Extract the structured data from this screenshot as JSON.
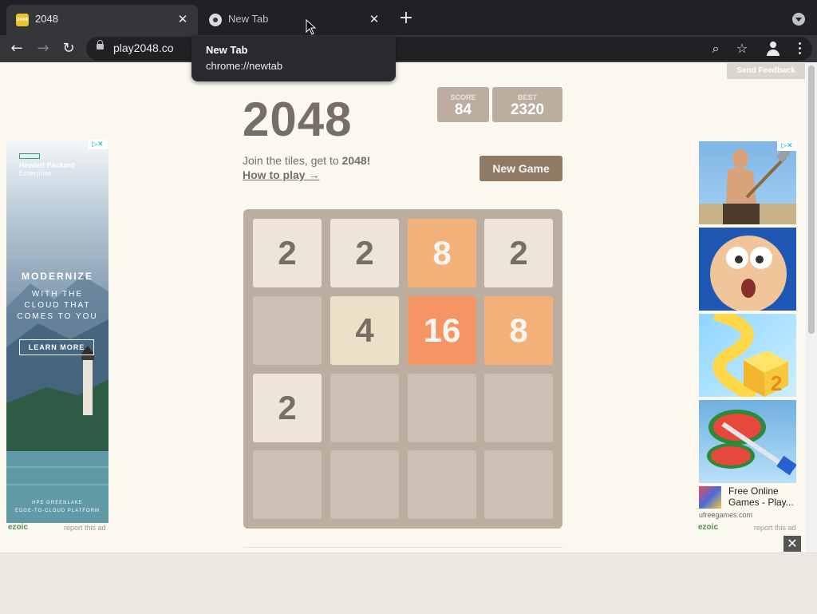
{
  "browser": {
    "tabs": [
      {
        "title": "2048",
        "favicon_text": "2048",
        "active": true
      },
      {
        "title": "New Tab",
        "active": false
      }
    ],
    "url": "play2048.co",
    "tooltip": {
      "title": "New Tab",
      "url": "chrome://newtab"
    }
  },
  "page": {
    "feedback_label": "Send Feedback",
    "game_title": "2048",
    "score": {
      "label": "SCORE",
      "value": "84"
    },
    "best": {
      "label": "BEST",
      "value": "2320"
    },
    "intro_text": "Join the tiles, get to ",
    "intro_goal": "2048!",
    "howto_label": "How to play →",
    "new_game_label": "New Game",
    "board": [
      [
        "2",
        "2",
        "8",
        "2"
      ],
      [
        "",
        "4",
        "16",
        "8"
      ],
      [
        "2",
        "",
        "",
        ""
      ],
      [
        "",
        "",
        "",
        ""
      ]
    ]
  },
  "ad_left": {
    "brand": "Hewlett Packard",
    "brand_sub": "Enterprise",
    "headline": "MODERNIZE",
    "tagline": [
      "WITH THE",
      "CLOUD THAT",
      "COMES TO YOU"
    ],
    "cta": "LEARN MORE",
    "footer": [
      "HPE GREENLAKE",
      "EDGE-TO-CLOUD PLATFORM"
    ],
    "network": "ezoic",
    "report": "report this ad"
  },
  "ad_right": {
    "caption": "Free Online Games - Play...",
    "domain": "ufreegames.com",
    "network": "ezoic",
    "report": "report this ad"
  },
  "colors": {
    "tile2": "#eee4da",
    "tile4": "#ede0c8",
    "tile8": "#f2b179",
    "tile16": "#f59563",
    "board": "#bbada0",
    "text": "#776e65"
  }
}
